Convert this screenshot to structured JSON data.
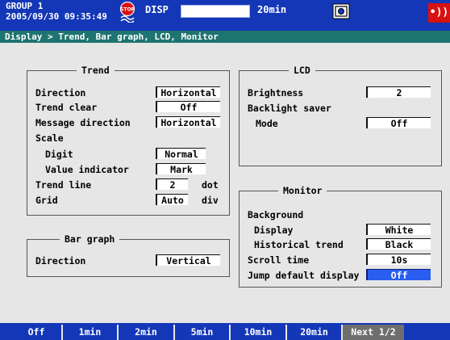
{
  "header": {
    "group_line1": "GROUP 1",
    "group_line2": "2005/09/30 09:35:49",
    "stop_icon_text": "STOP",
    "disp_label": "DISP",
    "disp_time": "20min",
    "alarm_icon_text": "•))"
  },
  "breadcrumb": "Display > Trend, Bar graph, LCD, Monitor",
  "trend": {
    "title": "Trend",
    "direction_label": "Direction",
    "direction_value": "Horizontal",
    "trend_clear_label": "Trend clear",
    "trend_clear_value": "Off",
    "message_direction_label": "Message direction",
    "message_direction_value": "Horizontal",
    "scale_label": "Scale",
    "digit_label": "Digit",
    "digit_value": "Normal",
    "value_indicator_label": "Value indicator",
    "value_indicator_value": "Mark",
    "trend_line_label": "Trend line",
    "trend_line_value": "2",
    "trend_line_unit": "dot",
    "grid_label": "Grid",
    "grid_value": "Auto",
    "grid_unit": "div"
  },
  "bar_graph": {
    "title": "Bar graph",
    "direction_label": "Direction",
    "direction_value": "Vertical"
  },
  "lcd": {
    "title": "LCD",
    "brightness_label": "Brightness",
    "brightness_value": "2",
    "backlight_saver_label": "Backlight saver",
    "mode_label": "Mode",
    "mode_value": "Off"
  },
  "monitor": {
    "title": "Monitor",
    "background_label": "Background",
    "display_label": "Display",
    "display_value": "White",
    "historical_trend_label": "Historical trend",
    "historical_trend_value": "Black",
    "scroll_time_label": "Scroll time",
    "scroll_time_value": "10s",
    "jump_default_label": "Jump default display",
    "jump_default_value": "Off"
  },
  "softkeys": [
    "Off",
    "1min",
    "2min",
    "5min",
    "10min",
    "20min",
    "Next 1/2"
  ],
  "colors": {
    "header_blue": "#1437b8",
    "breadcrumb_teal": "#1e7470",
    "selection_blue": "#2a5ef0",
    "alarm_red": "#d81111"
  }
}
